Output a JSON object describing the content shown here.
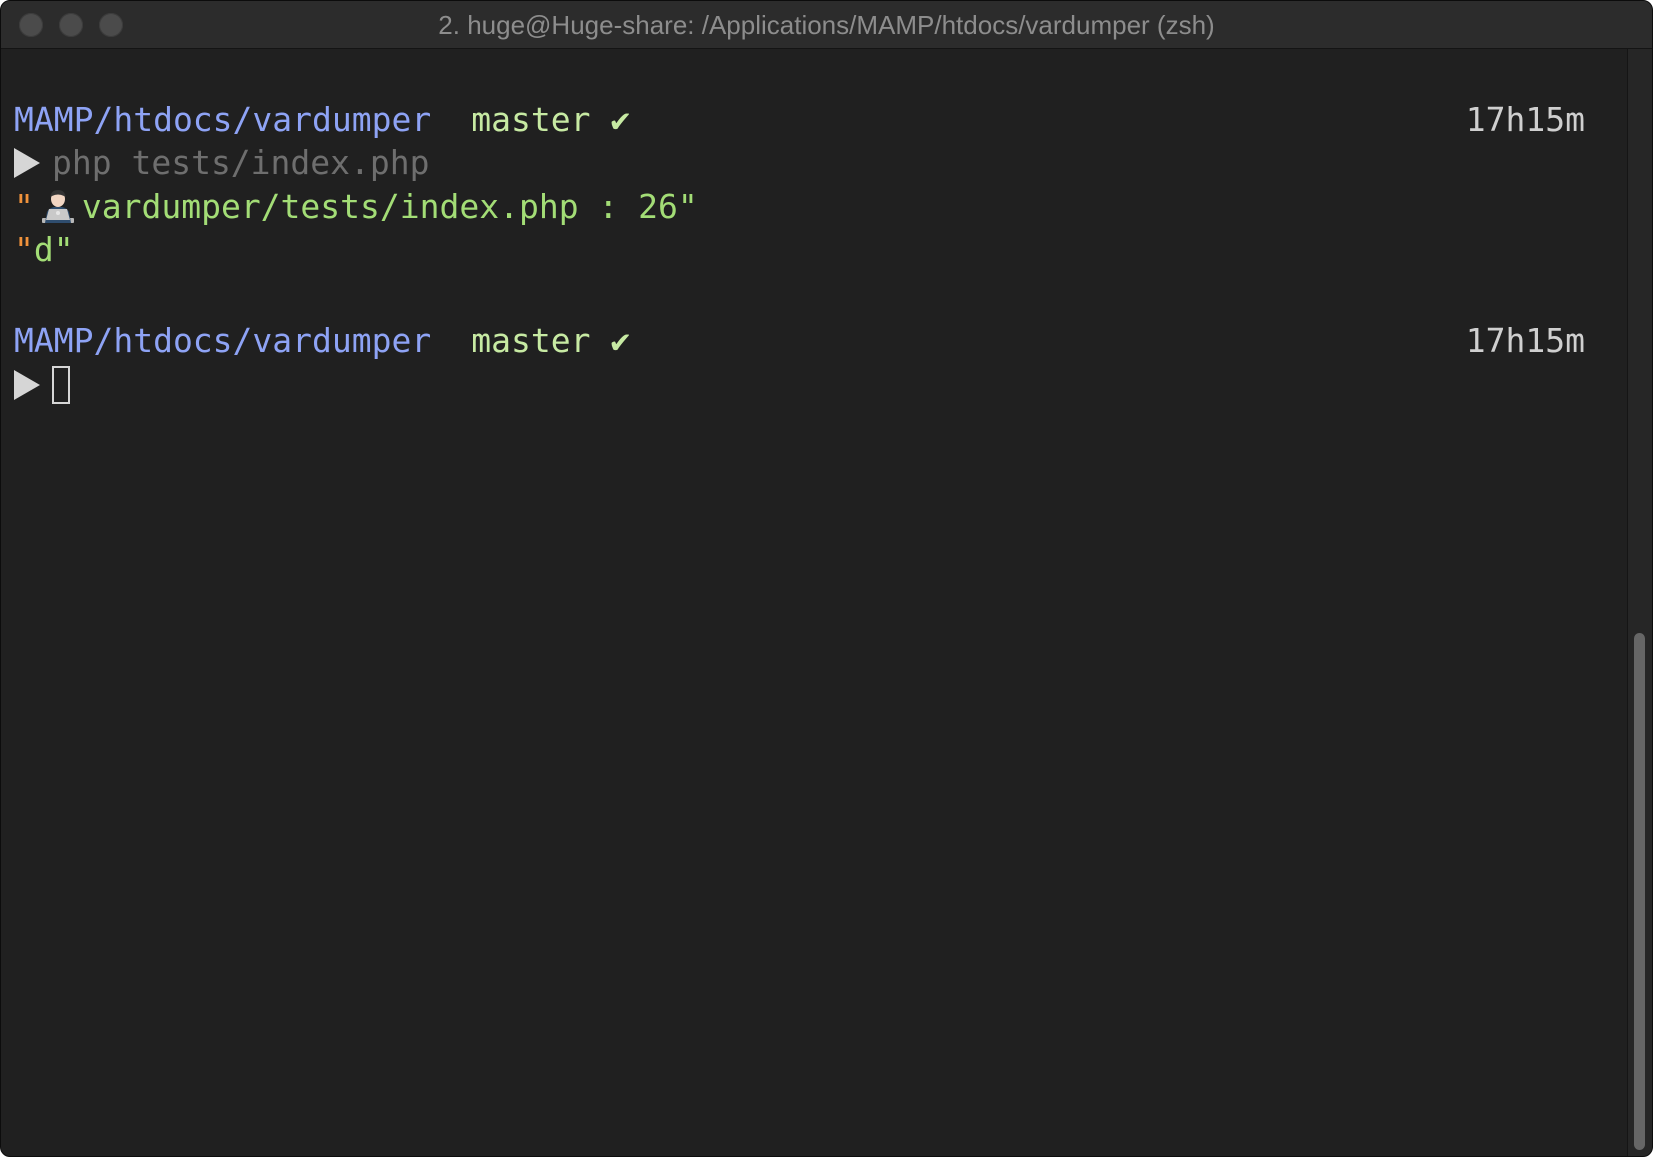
{
  "window": {
    "title": "2. huge@Huge-share: /Applications/MAMP/htdocs/vardumper (zsh)"
  },
  "terminal": {
    "prompt1": {
      "path": "MAMP/htdocs/vardumper",
      "branch": "master",
      "status_glyph": "✔",
      "elapsed": "17h15m"
    },
    "command": "php tests/index.php",
    "output": [
      {
        "open_quote": "\"",
        "icon": "technologist-emoji",
        "text": "vardumper/tests/index.php : 26",
        "close_quote": "\""
      },
      {
        "open_quote": "\"",
        "text": "d",
        "close_quote": "\""
      }
    ],
    "prompt2": {
      "path": "MAMP/htdocs/vardumper",
      "branch": "master",
      "status_glyph": "✔",
      "elapsed": "17h15m"
    }
  },
  "scrollbar": {
    "visible_fraction": 0.47,
    "position_fraction": 1.0
  },
  "colors": {
    "background": "#202020",
    "path": "#8ea3f5",
    "branch": "#c7eaa3",
    "string": "#a3dd76",
    "quote": "#f0923b",
    "command": "#6e6e6e"
  }
}
